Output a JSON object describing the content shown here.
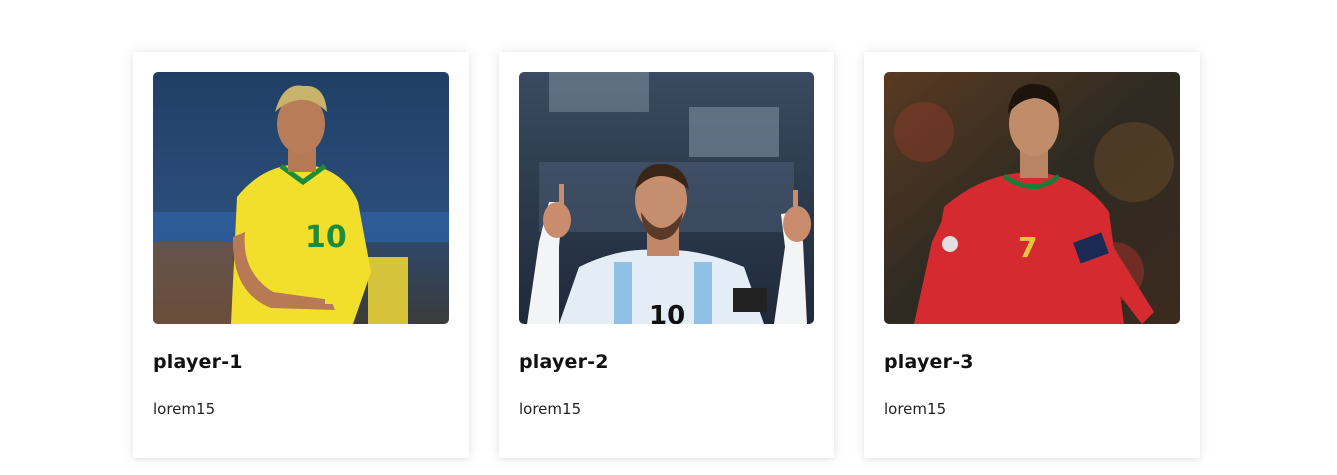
{
  "cards": [
    {
      "title": "player-1",
      "description": "lorem15",
      "jersey_number": "10",
      "photo_colors": {
        "jersey": "#f2e02a",
        "background": "#1d3a5c"
      }
    },
    {
      "title": "player-2",
      "description": "lorem15",
      "jersey_number": "10",
      "photo_colors": {
        "jersey": "#dce9f3",
        "background": "#2e3d52"
      }
    },
    {
      "title": "player-3",
      "description": "lorem15",
      "jersey_number": "7",
      "photo_colors": {
        "jersey": "#d42a2f",
        "background": "#3a2a1e"
      }
    }
  ]
}
